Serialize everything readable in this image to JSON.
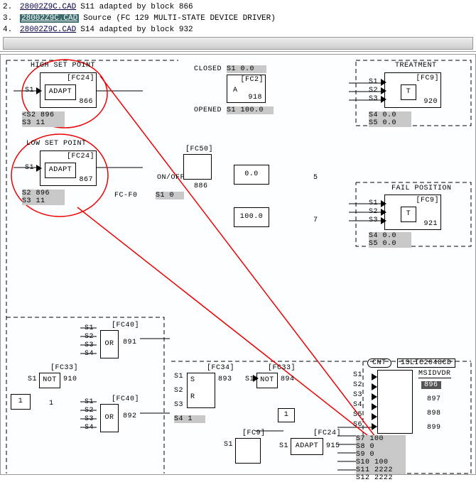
{
  "list": {
    "items": [
      {
        "n": "2.",
        "file": "28002Z9C.CAD",
        "desc": "S11 adapted by block 866"
      },
      {
        "n": "3.",
        "file": "28002Z9C.CAD",
        "desc": "Source (FC 129 MULTI-STATE DEVICE DRIVER)",
        "hl": true
      },
      {
        "n": "4.",
        "file": "28002Z9C.CAD",
        "desc": "S14 adapted by block 932"
      }
    ]
  },
  "hsp": {
    "title": "HIGH SET POINT",
    "fc": "[FC24]",
    "label": "ADAPT",
    "id": "866",
    "s1": "S1",
    "a": "<S2  896",
    "b": "S3  11"
  },
  "lsp": {
    "title": "LOW SET POINT",
    "fc": "[FC24]",
    "label": "ADAPT",
    "id": "867",
    "s1": "S1",
    "a": "S2  896",
    "b": "S3  11"
  },
  "closed": "CLOSED",
  "opened": "OPENED",
  "s1_00": "S1  0.0",
  "s1_100": "S1  100.0",
  "fc2": "[FC2]",
  "A": "A",
  "id918": "918",
  "treat": {
    "title": "TREATMENT",
    "fc": "[FC9]",
    "T": "T",
    "id": "920",
    "s1": "S1",
    "s2": "S2",
    "s3": "S3",
    "s4": "S4  0.0",
    "s5": "S5  0.0"
  },
  "fc50": "[FC50]",
  "onoff": "ON/OFF",
  "id886": "886",
  "fcf0": "FC-F0",
  "s1_0": "S1  0",
  "v00": "0.0",
  "v100": "100.0",
  "n5": "5",
  "n7": "7",
  "fail": {
    "title": "FAIL POSITION",
    "fc": "[FC9]",
    "T": "T",
    "id": "921",
    "s1": "S1",
    "s2": "S2",
    "s3": "S3",
    "s4": "S4  0.0",
    "s5": "S5  0.0"
  },
  "or1": {
    "fc": "[FC40]",
    "label": "OR",
    "id": "891",
    "s": [
      "S1",
      "S2",
      "S3",
      "S4"
    ]
  },
  "or2": {
    "fc": "[FC40]",
    "label": "OR",
    "id": "892",
    "s": [
      "S1",
      "S2",
      "S3",
      "S4"
    ]
  },
  "not1": {
    "fc": "[FC33]",
    "label": "NOT",
    "id": "910",
    "s": "S1"
  },
  "one": "1",
  "one2": "1",
  "one3": "1",
  "sr": {
    "fc": "[FC34]",
    "id": "893",
    "s1": "S1",
    "s2": "S2",
    "s3": "S3",
    "S": "S",
    "R": "R",
    "s4": "S4  1"
  },
  "not2": {
    "fc": "[FC33]",
    "label": "NOT",
    "id": "894",
    "s": "S1"
  },
  "adapt2": {
    "fc": "[FC24]",
    "label": "ADAPT",
    "id": "915",
    "s": "S1"
  },
  "fc9b": "[FC9]",
  "s1b": "S1",
  "cnt": "CNT",
  "tag": "13LIC2048CD",
  "msd": "MSIDVDR",
  "ids": {
    "a": "896",
    "b": "897",
    "c": "898",
    "d": "899"
  },
  "sl": [
    "S1",
    "S2",
    "S3",
    "S4",
    "S5",
    "S6"
  ],
  "bot": [
    "S7  100",
    "S8  0",
    "S9  0",
    "S10 100",
    "S11 2222",
    "S12 2222"
  ]
}
